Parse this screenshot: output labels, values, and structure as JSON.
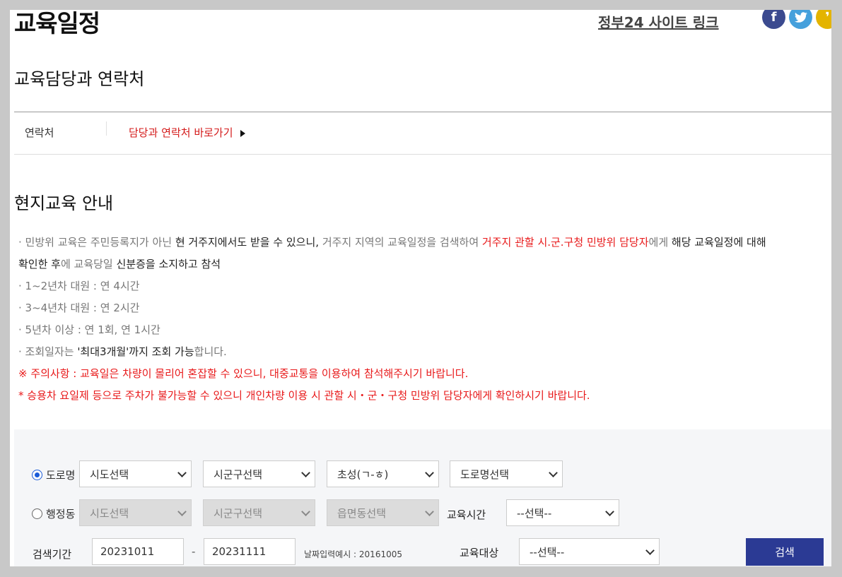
{
  "header": {
    "title": "교육일정",
    "gov_link": "정부24 사이트 링크",
    "social": [
      {
        "name": "facebook-icon",
        "glyph": "f",
        "color": "#3b4a8f"
      },
      {
        "name": "twitter-icon",
        "glyph": "🐦",
        "color": "#45a0dc"
      },
      {
        "name": "kakaostory-icon",
        "glyph": "❜",
        "color": "#e4b400"
      }
    ]
  },
  "contact_section": {
    "title": "교육담당과 연락처",
    "label": "연락처",
    "link": "담당과 연락처 바로가기"
  },
  "guide_section": {
    "title": "현지교육 안내",
    "lines": {
      "l1_a": "· 민방위 교육은 주민등록지가 아닌 ",
      "l1_b": "현 거주지에서도 받을 수 있으니,",
      "l1_c": " 거주지 지역의 교육일정을 검색하여 ",
      "l1_d": "거주지 관할 시.군.구청 민방위 담당자",
      "l1_e": "에게 ",
      "l1_f": "해당 교육일정에 대해",
      "l2_a": "확인한 후",
      "l2_b": "에 교육당일 ",
      "l2_c": "신분증을 소지하고 참석",
      "l3": "· 1~2년차 대원 : 연 4시간",
      "l4": "· 3~4년차 대원 : 연 2시간",
      "l5": "· 5년차 이상 : 연 1회, 연 1시간",
      "l6_a": "· 조회일자는 ",
      "l6_b": "'최대3개월'까지 조회 가능",
      "l6_c": "합니다.",
      "l7": "※ 주의사항 : 교육일은 차량이 몰리어 혼잡할 수 있으니, 대중교통을 이용하여 참석해주시기 바랍니다.",
      "l8": "* 승용차 요일제 등으로 주차가 불가능할 수 있으니 개인차량 이용 시 관할 시・군・구청 민방위 담당자에게 확인하시기 바랍니다."
    }
  },
  "search": {
    "road": {
      "label": "도로명",
      "checked": true,
      "selects": [
        "시도선택",
        "시군구선택",
        "초성(ㄱ-ㅎ)",
        "도로명선택"
      ]
    },
    "admin": {
      "label": "행정동",
      "checked": false,
      "selects": [
        "시도선택",
        "시군구선택",
        "읍면동선택"
      ]
    },
    "edu_time": {
      "label": "교육시간",
      "value": "--선택--"
    },
    "period": {
      "label": "검색기간",
      "from": "20231011",
      "separator": "-",
      "to": "20231111",
      "hint": "날짜입력예시 : 20161005"
    },
    "edu_target": {
      "label": "교육대상",
      "value": "--선택--"
    },
    "button": "검색"
  }
}
